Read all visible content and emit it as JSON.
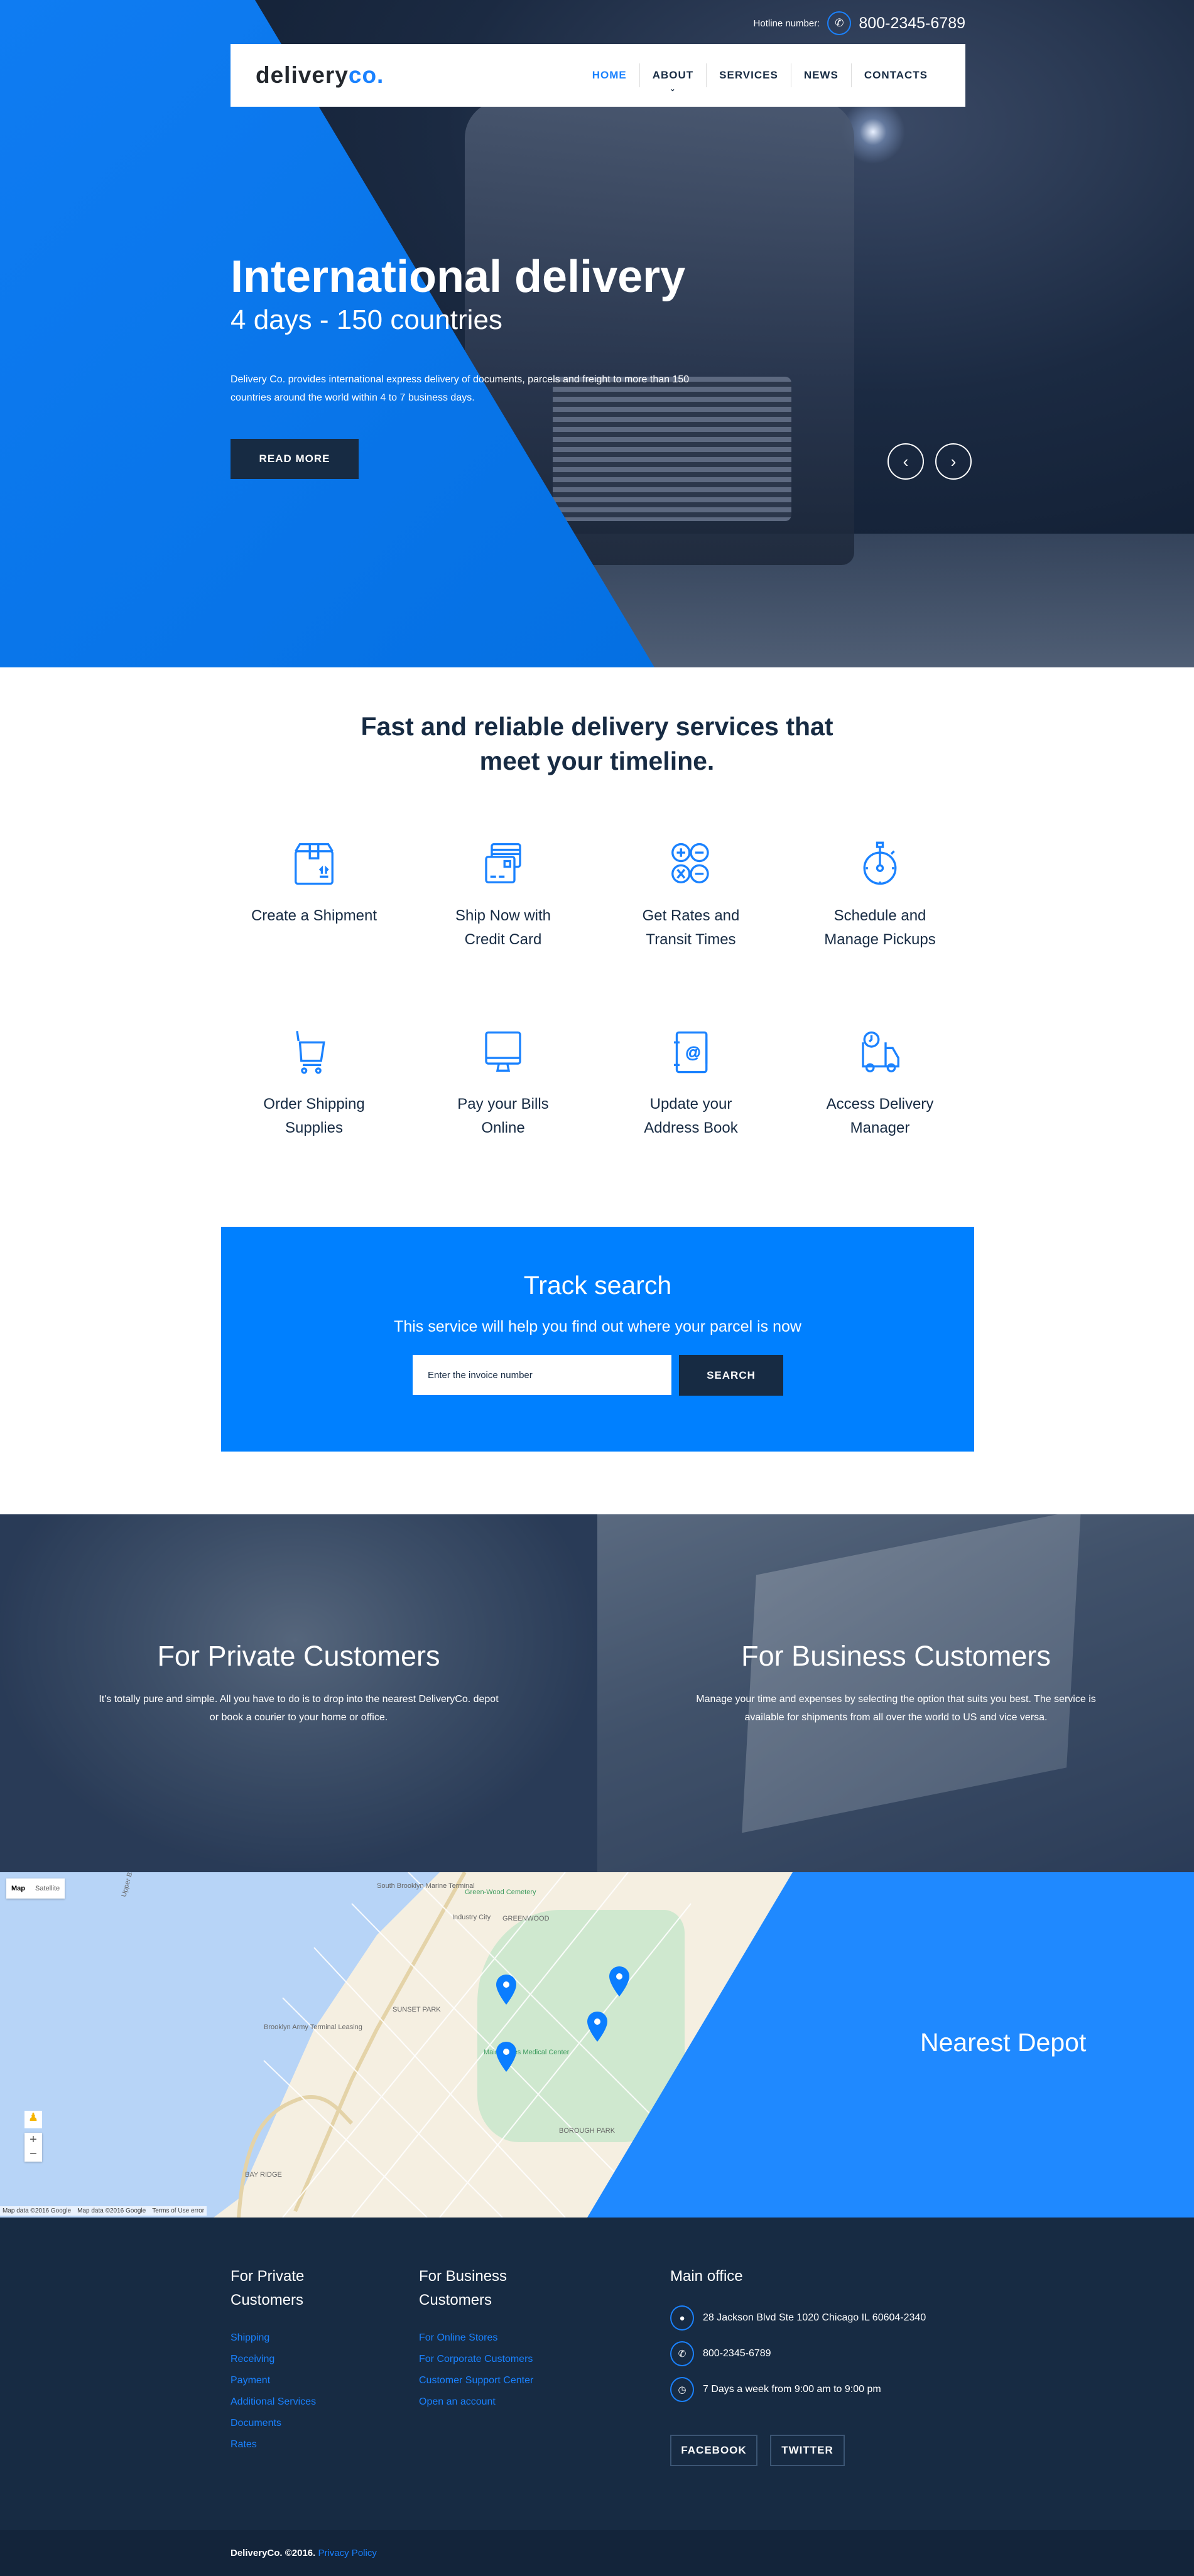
{
  "header": {
    "hotline_label": "Hotline number:",
    "hotline_number": "800-2345-6789",
    "logo_main": "delivery",
    "logo_accent": "co.",
    "nav": [
      {
        "label": "HOME",
        "active": true
      },
      {
        "label": "ABOUT",
        "has_dropdown": true
      },
      {
        "label": "SERVICES"
      },
      {
        "label": "NEWS"
      },
      {
        "label": "CONTACTS"
      }
    ]
  },
  "hero": {
    "title": "International delivery",
    "subtitle": "4 days - 150 countries",
    "text": "Delivery Co. provides international express delivery of documents, parcels and freight to more than 150 countries around the world within 4 to 7 business days.",
    "button": "READ MORE",
    "prev_icon": "chevron-left-icon",
    "next_icon": "chevron-right-icon"
  },
  "services": {
    "heading_line1": "Fast and reliable delivery services that",
    "heading_line2": "meet your timeline.",
    "items": [
      {
        "line1": "Create a Shipment",
        "line2": "",
        "icon": "package-icon"
      },
      {
        "line1": "Ship Now with",
        "line2": "Credit Card",
        "icon": "credit-card-icon"
      },
      {
        "line1": "Get Rates and",
        "line2": "Transit Times",
        "icon": "calculator-icon"
      },
      {
        "line1": "Schedule and",
        "line2": "Manage Pickups",
        "icon": "stopwatch-icon"
      },
      {
        "line1": "Order Shipping",
        "line2": "Supplies",
        "icon": "cart-icon"
      },
      {
        "line1": "Pay your Bills",
        "line2": "Online",
        "icon": "monitor-icon"
      },
      {
        "line1": "Update your",
        "line2": "Address Book",
        "icon": "address-book-icon"
      },
      {
        "line1": "Access Delivery",
        "line2": "Manager",
        "icon": "delivery-truck-icon"
      }
    ]
  },
  "track": {
    "title": "Track search",
    "subtitle": "This service will help you find out where your parcel is now",
    "placeholder": "Enter the invoice number",
    "button": "SEARCH"
  },
  "customers": {
    "private": {
      "title": "For Private Customers",
      "text": "It's totally pure and simple. All you have to do is to drop into the nearest DeliveryCo. depot or book a courier to your home or office."
    },
    "business": {
      "title": "For Business Customers",
      "text": "Manage your time and expenses by selecting the option that suits you best. The service is available for shipments from all over the world to US and vice versa."
    }
  },
  "map": {
    "type_map": "Map",
    "type_satellite": "Satellite",
    "labels": [
      "South Brooklyn Marine Terminal",
      "Green-Wood Cemetery",
      "Industry City",
      "GREENWOOD",
      "SUNSET PARK",
      "Brooklyn Army Terminal Leasing",
      "Maimonides Medical Center",
      "BOROUGH PARK",
      "BAY RIDGE",
      "Upper Bay"
    ],
    "attribution": "Map data ©2016 Google",
    "terms": "Terms of Use",
    "error": "error",
    "zoom_in": "+",
    "zoom_out": "−",
    "nearest_title": "Nearest Depot",
    "accent": "#1f89ff"
  },
  "footer": {
    "private_title_1": "For Private",
    "private_title_2": "Customers",
    "private_links": [
      "Shipping",
      "Receiving",
      "Payment",
      "Additional Services",
      "Documents",
      "Rates"
    ],
    "business_title_1": "For Business",
    "business_title_2": "Customers",
    "business_links": [
      "For Online Stores",
      "For Corporate Customers",
      "Customer Support Center",
      "Open an account"
    ],
    "office_title": "Main office",
    "address": "28 Jackson Blvd Ste 1020 Chicago IL 60604-2340",
    "phone": "800-2345-6789",
    "hours": "7 Days a week from 9:00 am to 9:00 pm",
    "facebook": "FACEBOOK",
    "twitter": "TWITTER",
    "copyright": "DeliveryCo. ©2016.",
    "privacy": "Privacy Policy"
  },
  "colors": {
    "primary": "#0080ff",
    "dark": "#172b43",
    "darker": "#13243a"
  }
}
